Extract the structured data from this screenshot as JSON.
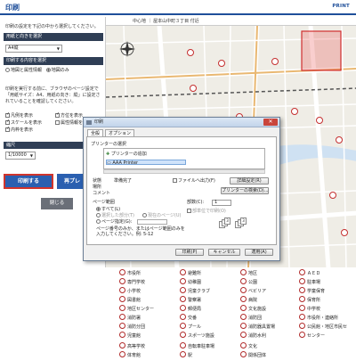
{
  "header": {
    "title": "印刷",
    "print_link": "PRINT"
  },
  "left": {
    "instruction": "印刷の設定を下記の中から選択してください。",
    "paper_section": "用紙と向きを選択",
    "paper_select": "A4縦",
    "content_section": "印刷する内容を選択",
    "content_options": [
      "地図と属性情報",
      "地図のみ"
    ],
    "note": "印刷を実行する前に、ブラウザのページ設定で「用紙サイズ：A4、用紙の向き：縦」に設定されていることを確認してください。",
    "checkboxes": [
      "凡例を表示",
      "方位を表示",
      "スケールを表示",
      "属性情報を表示",
      "内枠を表示"
    ],
    "scale_section": "縮尺",
    "scale_select": "1/10000",
    "print_button": "印刷する",
    "reselect_button": "再プレ",
    "close_button": "閉じる"
  },
  "map": {
    "header_text": "中心地 ｜ 屋本山中町３丁目 付近"
  },
  "legend": {
    "items": [
      "市役所",
      "避難所",
      "地区",
      "ＡＥＤ",
      "専門学校",
      "幼稚園",
      "公園",
      "駐車場",
      "小学校",
      "児童クラブ",
      "ベビリア",
      "学童保育",
      "図書館",
      "警察署",
      "病院",
      "保育所",
      "地区センター",
      "郵便局",
      "文化施設",
      "中学校",
      "消防署",
      "交番",
      "消防団",
      "市役所・連絡所",
      "消防分団",
      "プール",
      "消防器具置場",
      "公民館・地区市民セ",
      "児童館",
      "スポーツ施設",
      "消防水利",
      "センター",
      "高等学校",
      "自転車駐車場",
      "文化",
      "体育館",
      "駅",
      "関係団体"
    ]
  },
  "dialog": {
    "title": "印刷",
    "close_glyph": "✕",
    "tabs": [
      "全般",
      "オプション"
    ],
    "printer_group": "プリンターの選択",
    "printers": [
      "プリンターの追加",
      "AAA Printer"
    ],
    "status_label": "状態",
    "status_value": "準備完了",
    "location_label": "場所",
    "comment_label": "コメント",
    "print_to_file": "ファイルへ出力(F)",
    "preferences_button": "詳細設定(R)",
    "find_printer_button": "プリンターの検索(D)...",
    "page_range_group": "ページ範囲",
    "range_all": "すべて(L)",
    "range_selection": "選択した部分(T)",
    "range_current": "現在のページ(U)",
    "range_pages": "ページ指定(G):",
    "range_hint": "ページ番号のみか、またはページ範囲のみを入力してください。例: 5-12",
    "copies_label": "部数(C):",
    "copies_value": "1",
    "collate_label": "部単位で印刷(O)",
    "print_button": "印刷(P)",
    "cancel_button": "キャンセル",
    "apply_button": "適用(A)"
  }
}
